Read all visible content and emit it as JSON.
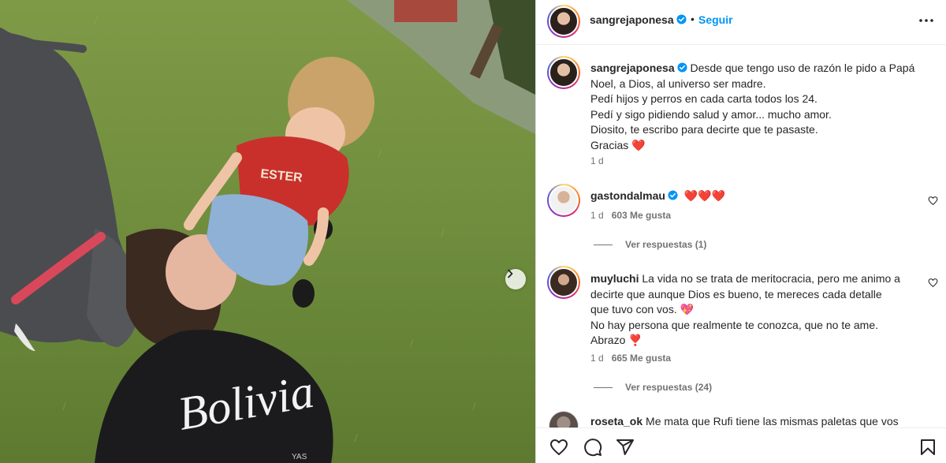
{
  "post": {
    "author": "sangrejaponesa",
    "follow_label": "Seguir",
    "separator": "•",
    "caption_lines": [
      "Desde que tengo uso de razón le pido a Papá",
      "Noel, a Dios, al universo ser madre.",
      "Pedí hijos y perros en cada carta todos los 24.",
      "Pedí y sigo pidiendo salud y amor... mucho amor.",
      "Diosito, te escribo para decirte que te pasaste.",
      "Gracias"
    ],
    "caption_emoji": "❤️",
    "caption_time": "1 d",
    "shirt_text": "ESTER",
    "sweatshirt_text": "Bolivia",
    "sweatshirt_small": "YAS"
  },
  "comments": [
    {
      "user": "gastondalmau",
      "text": "❤️❤️❤️",
      "time": "1 d",
      "likes": "603 Me gusta",
      "replies": "Ver respuestas (1)"
    },
    {
      "user": "muyluchi",
      "lines": [
        "La vida no se trata de meritocracia, pero me animo a",
        "decirte que aunque Dios es bueno, te mereces cada detalle",
        "que tuvo con vos. 💖",
        "No hay persona que realmente te conozca, que no te ame.",
        "Abrazo ❣️"
      ],
      "time": "1 d",
      "likes": "665 Me gusta",
      "replies": "Ver respuestas (24)"
    },
    {
      "user": "roseta_ok",
      "text": "Me mata que Rufi tiene las mismas paletas que vos"
    }
  ],
  "icons": [
    "heart-icon",
    "comment-icon",
    "share-icon",
    "bookmark-icon",
    "more-options-icon",
    "verified-icon",
    "chevron-right-icon"
  ],
  "colors": {
    "accent": "#0095f6",
    "text": "#262626",
    "secondary": "#737373",
    "heart": "#ed4956"
  }
}
